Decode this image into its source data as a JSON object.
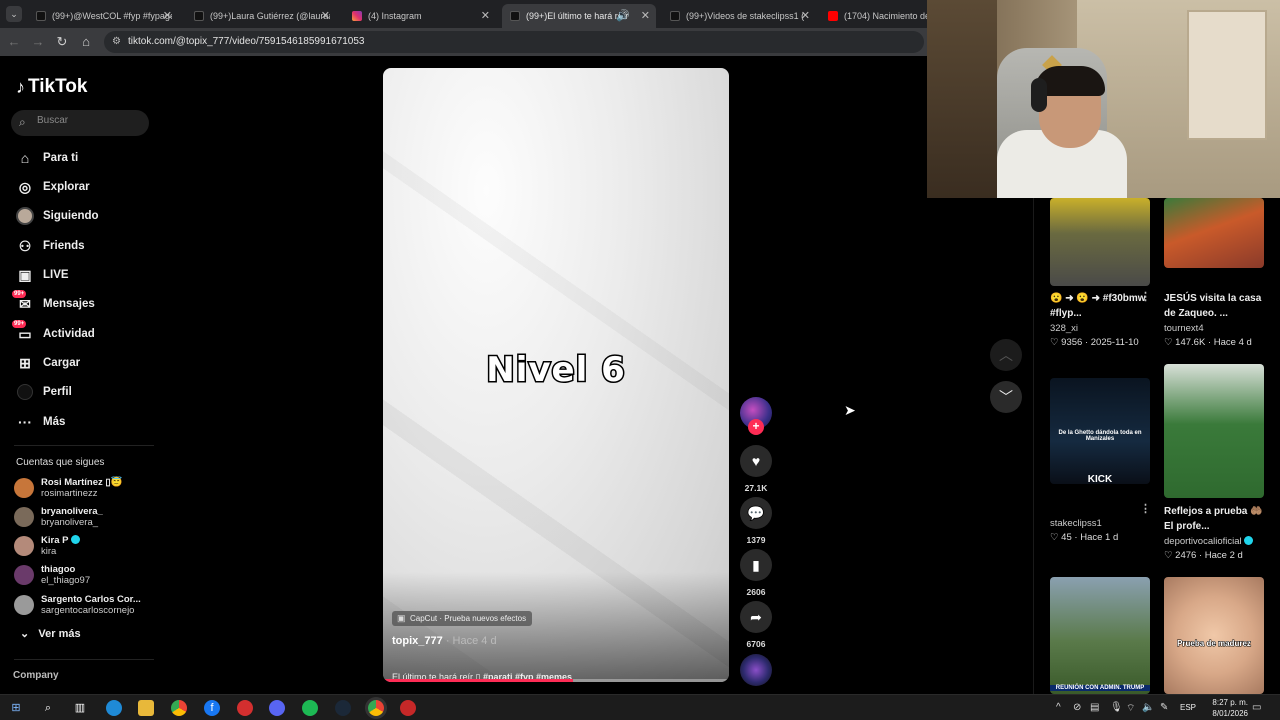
{
  "browser": {
    "tabs": [
      {
        "title": "(99+)@WestCOL #fyp #fypage",
        "active": false,
        "icon": "tiktok-icon"
      },
      {
        "title": "(99+)Laura Gutiérrez (@lauraag",
        "active": false,
        "icon": "tiktok-icon"
      },
      {
        "title": "(4) Instagram",
        "active": false,
        "icon": "instagram-icon"
      },
      {
        "title": "(99+)El último te hará reír D",
        "active": true,
        "icon": "tiktok-icon"
      },
      {
        "title": "(99+)Videos de stakeclipss1 (",
        "active": false,
        "icon": "tiktok-icon"
      },
      {
        "title": "(1704) Nacimiento de nu",
        "active": false,
        "icon": "youtube-icon"
      }
    ],
    "url": "tiktok.com/@topix_777/video/7591546185991671053"
  },
  "sidebar": {
    "logo": "TikTok",
    "search_placeholder": "Buscar",
    "nav": [
      {
        "label": "Para ti",
        "icon": "home-icon"
      },
      {
        "label": "Explorar",
        "icon": "compass-icon"
      },
      {
        "label": "Siguiendo",
        "icon": "following-avatar-icon"
      },
      {
        "label": "Friends",
        "icon": "friends-icon"
      },
      {
        "label": "LIVE",
        "icon": "live-icon"
      },
      {
        "label": "Mensajes",
        "icon": "messages-icon",
        "badge": "99+"
      },
      {
        "label": "Actividad",
        "icon": "activity-icon",
        "badge": "99+"
      },
      {
        "label": "Cargar",
        "icon": "upload-icon"
      },
      {
        "label": "Perfil",
        "icon": "profile-avatar-icon"
      },
      {
        "label": "Más",
        "icon": "more-icon"
      }
    ],
    "following_title": "Cuentas que sigues",
    "following": [
      {
        "name": "Rosi Martínez ▯😇",
        "handle": "rosimartinezz",
        "verified": false,
        "color": "#c7763a"
      },
      {
        "name": "bryanolivera_",
        "handle": "bryanolivera_",
        "verified": false,
        "color": "#7a6a5a"
      },
      {
        "name": "Kira P",
        "handle": "kira",
        "verified": true,
        "color": "#b48a7a"
      },
      {
        "name": "thiagoo",
        "handle": "el_thiago97",
        "verified": false,
        "color": "#6a3a6a"
      },
      {
        "name": "Sargento Carlos Cor...",
        "handle": "sargentocarloscornejo",
        "verified": false,
        "color": "#9a9a9a"
      }
    ],
    "see_more": "Ver más",
    "company": "Company"
  },
  "video": {
    "overlay_text": "Nivel 6",
    "capcut_label": "CapCut · Prueba nuevos efectos",
    "author": "topix_777",
    "posted": "· Hace 4 d",
    "description": "El último te hará reír ▯ ",
    "hashtags": "#parati #fyp #memes",
    "progress": 0.55
  },
  "actions": {
    "likes": "27.1K",
    "comments": "1379",
    "saves": "2606",
    "shares": "6706"
  },
  "grid": [
    {
      "title": "😮 ➜ 😮 ➜ #f30bmw #flyp...",
      "author": "328_xi",
      "likes": "9356",
      "date": "2025-11-10",
      "verified": false
    },
    {
      "title": "JESÚS visita la casa de Zaqueo. ...",
      "author": "tournext4",
      "likes": "147.6K",
      "date": "Hace 4 d",
      "verified": false
    },
    {
      "title": "",
      "author": "stakeclipss1",
      "likes": "45",
      "date": "Hace 1 d",
      "verified": false,
      "overlay1": "De la Ghetto dándola toda en Manizales",
      "overlay2": "KICK"
    },
    {
      "title": "Reflejos a prueba 🤲🏽 El profe...",
      "author": "deportivocalioficial",
      "likes": "2476",
      "date": "Hace 2 d",
      "verified": true
    },
    {
      "title": "",
      "author": "",
      "likes": "",
      "date": "",
      "overlay1": "REUNIÓN CON ADMIN. TRUMP"
    },
    {
      "title": "",
      "author": "",
      "likes": "",
      "date": "",
      "overlay1": "Prueba de madurez"
    }
  ],
  "taskbar": {
    "time": "8:27 p. m.",
    "date": "8/01/2026",
    "lang": "ESP"
  },
  "colors": {
    "accent": "#fe2c55",
    "background": "#000000",
    "verified": "#20d5ec"
  }
}
